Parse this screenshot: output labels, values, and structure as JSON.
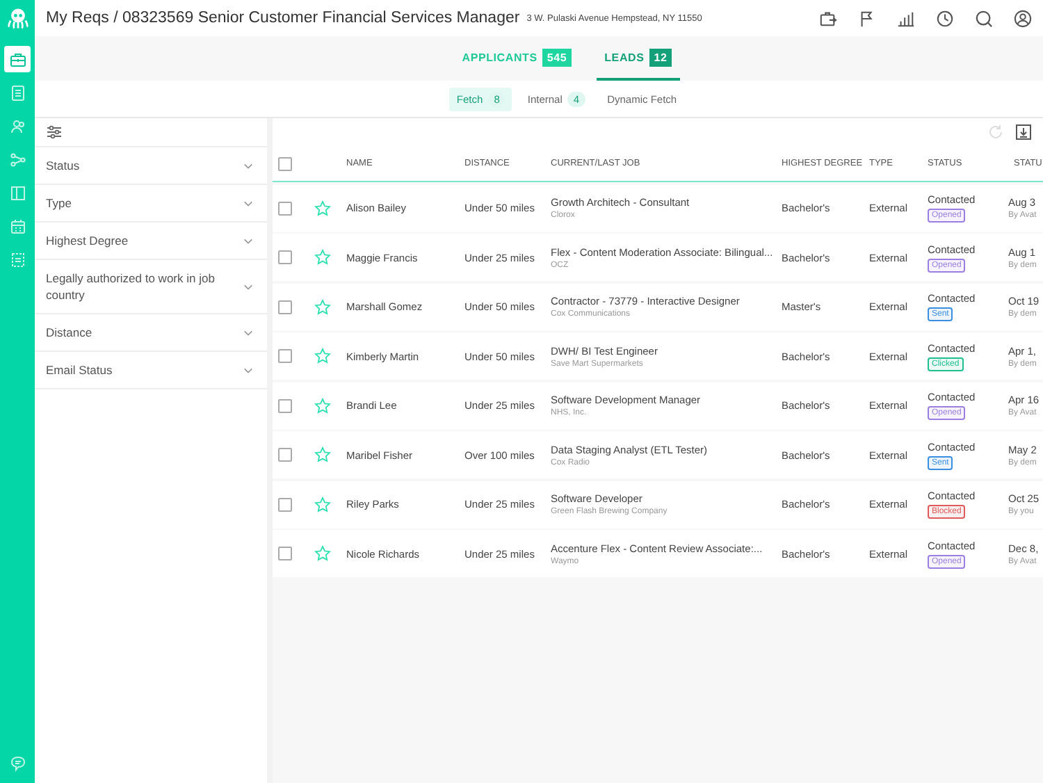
{
  "header": {
    "title": "My Reqs / 08323569 Senior Customer Financial Services Manager",
    "address": "3 W. Pulaski Avenue Hempstead, NY 11550"
  },
  "rail": {
    "items": [
      {
        "kind": "briefcase",
        "selected": true
      },
      {
        "kind": "documents",
        "selected": false
      },
      {
        "kind": "people",
        "selected": false
      },
      {
        "kind": "share",
        "selected": false
      },
      {
        "kind": "columns",
        "selected": false
      },
      {
        "kind": "calendar",
        "selected": false
      },
      {
        "kind": "report",
        "selected": false
      }
    ]
  },
  "tabs": [
    {
      "label": "APPLICANTS",
      "count": "545",
      "selected": false
    },
    {
      "label": "LEADS",
      "count": "12",
      "selected": true
    }
  ],
  "subtabs": [
    {
      "label": "Fetch",
      "count": "8",
      "selected": true
    },
    {
      "label": "Internal",
      "count": "4",
      "selected": false
    },
    {
      "label": "Dynamic Fetch",
      "selected": false
    }
  ],
  "filters": [
    {
      "label": "Status",
      "expanded": false
    },
    {
      "label": "Type",
      "expanded": false
    },
    {
      "label": "Highest Degree",
      "expanded": false
    },
    {
      "label": "Legally authorized to work in job country",
      "expanded": false
    },
    {
      "label": "Distance",
      "expanded": false
    },
    {
      "label": "Email Status",
      "expanded": false
    }
  ],
  "table": {
    "all_checked": false,
    "columns": [
      "NAME",
      "DISTANCE",
      "CURRENT/LAST JOB",
      "HIGHEST DEGREE",
      "TYPE",
      "STATUS",
      "STATU"
    ],
    "rows": [
      {
        "checked": false,
        "starred": false,
        "name": "Alison Bailey",
        "distance": "Under 50 miles",
        "job": "Growth Architech - Consultant",
        "company": "Clorox",
        "degree": "Bachelor's",
        "type": "External",
        "status": "Contacted",
        "badge": {
          "label": "Opened",
          "color": "#9b7fe0"
        },
        "date": "Aug 3",
        "by": "By Avat"
      },
      {
        "checked": false,
        "starred": false,
        "name": "Maggie Francis",
        "distance": "Under 25 miles",
        "job": "Flex - Content Moderation Associate: Bilingual...",
        "company": "OCZ",
        "degree": "Bachelor's",
        "type": "External",
        "status": "Contacted",
        "badge": {
          "label": "Opened",
          "color": "#9b7fe0"
        },
        "date": "Aug 1",
        "by": "By dem"
      },
      {
        "checked": false,
        "starred": false,
        "name": "Marshall Gomez",
        "distance": "Under 50 miles",
        "job": "Contractor - 73779 - Interactive Designer",
        "company": "Cox Communications",
        "degree": "Master's",
        "type": "External",
        "status": "Contacted",
        "badge": {
          "label": "Sent",
          "color": "#3b8fe0"
        },
        "date": "Oct 19",
        "by": "By dem"
      },
      {
        "checked": false,
        "starred": false,
        "name": "Kimberly Martin",
        "distance": "Under 50 miles",
        "job": "DWH/ BI Test Engineer",
        "company": "Save Mart Supermarkets",
        "degree": "Bachelor's",
        "type": "External",
        "status": "Contacted",
        "badge": {
          "label": "Clicked",
          "color": "#1fbf8f"
        },
        "date": "Apr 1,",
        "by": "By dem"
      },
      {
        "checked": false,
        "starred": false,
        "name": "Brandi Lee",
        "distance": "Under 25 miles",
        "job": "Software Development Manager",
        "company": "NHS, Inc.",
        "degree": "Bachelor's",
        "type": "External",
        "status": "Contacted",
        "badge": {
          "label": "Opened",
          "color": "#9b7fe0"
        },
        "date": "Apr 16",
        "by": "By Avat"
      },
      {
        "checked": false,
        "starred": false,
        "name": "Maribel Fisher",
        "distance": "Over 100 miles",
        "job": "Data Staging Analyst (ETL Tester)",
        "company": "Cox Radio",
        "degree": "Bachelor's",
        "type": "External",
        "status": "Contacted",
        "badge": {
          "label": "Sent",
          "color": "#3b8fe0"
        },
        "date": "May 2",
        "by": "By dem"
      },
      {
        "checked": false,
        "starred": false,
        "name": "Riley Parks",
        "distance": "Under 25 miles",
        "job": "Software Developer",
        "company": "Green Flash Brewing Company",
        "degree": "Bachelor's",
        "type": "External",
        "status": "Contacted",
        "badge": {
          "label": "Blocked",
          "color": "#e05a5a"
        },
        "date": "Oct 25",
        "by": "By you"
      },
      {
        "checked": false,
        "starred": false,
        "name": "Nicole Richards",
        "distance": "Under 25 miles",
        "job": "Accenture Flex - Content Review Associate:...",
        "company": "Waymo",
        "degree": "Bachelor's",
        "type": "External",
        "status": "Contacted",
        "badge": {
          "label": "Opened",
          "color": "#9b7fe0"
        },
        "date": "Dec 8,",
        "by": "By Avat"
      }
    ]
  }
}
